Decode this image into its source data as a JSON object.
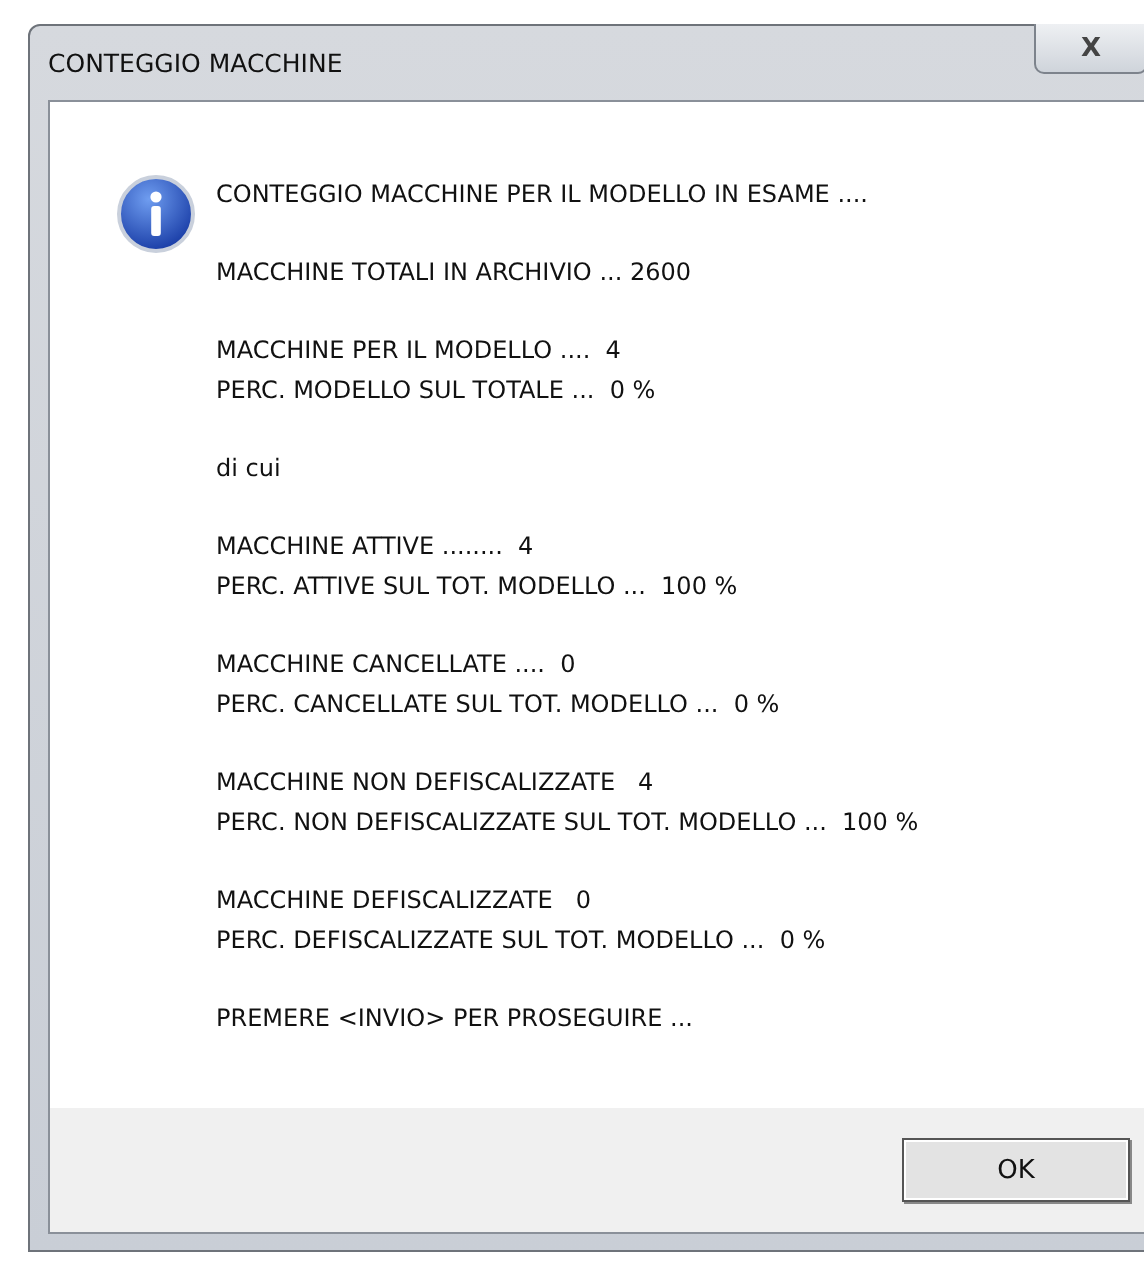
{
  "window": {
    "title": "CONTEGGIO MACCHINE",
    "close_label": "X"
  },
  "message": {
    "paragraphs": [
      [
        "CONTEGGIO MACCHINE PER IL MODELLO IN ESAME ...."
      ],
      [
        "MACCHINE TOTALI IN ARCHIVIO ... 2600"
      ],
      [
        "MACCHINE PER IL MODELLO ....  4",
        "PERC. MODELLO SUL TOTALE ...  0 %"
      ],
      [
        "di cui"
      ],
      [
        "MACCHINE ATTIVE ........  4",
        "PERC. ATTIVE SUL TOT. MODELLO ...  100 %"
      ],
      [
        "MACCHINE CANCELLATE ....  0",
        "PERC. CANCELLATE SUL TOT. MODELLO ...  0 %"
      ],
      [
        "MACCHINE NON DEFISCALIZZATE   4",
        "PERC. NON DEFISCALIZZATE SUL TOT. MODELLO ...  100 %"
      ],
      [
        "MACCHINE DEFISCALIZZATE   0",
        "PERC. DEFISCALIZZATE SUL TOT. MODELLO ...  0 %"
      ],
      [
        "PREMERE <INVIO> PER PROSEGUIRE ..."
      ]
    ]
  },
  "buttons": [
    "OK"
  ]
}
